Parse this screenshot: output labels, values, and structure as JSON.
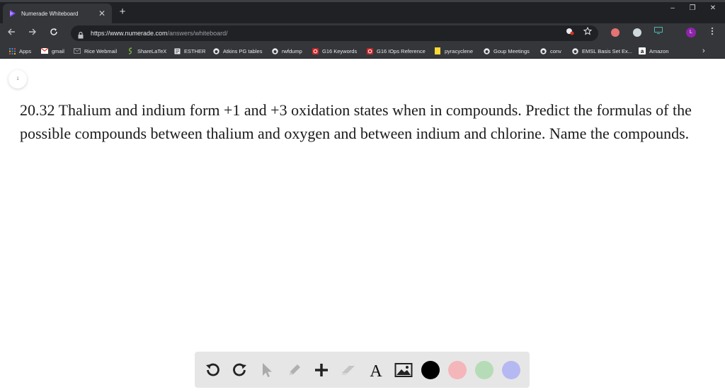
{
  "browser": {
    "tab": {
      "title": "Numerade Whiteboard",
      "close_glyph": "✕"
    },
    "new_tab_glyph": "+",
    "window_controls": {
      "minimize": "–",
      "restore": "❐",
      "close": "✕"
    },
    "url": {
      "host": "https://www.numerade.com",
      "path": "/answers/whiteboard/"
    },
    "avatar_letter": "L",
    "bookmarks": [
      {
        "label": "Apps",
        "icon": "apps-grid-icon"
      },
      {
        "label": "gmail",
        "icon": "gmail-icon"
      },
      {
        "label": "Rice Webmail",
        "icon": "webmail-icon"
      },
      {
        "label": "ShareLaTeX",
        "icon": "sharelatex-icon"
      },
      {
        "label": "ESTHER",
        "icon": "page-icon"
      },
      {
        "label": "Atkins PG tables",
        "icon": "github-icon"
      },
      {
        "label": "rwfdump",
        "icon": "github-icon"
      },
      {
        "label": "G16 Keywords",
        "icon": "gaussian-icon"
      },
      {
        "label": "G16 IOps Reference",
        "icon": "gaussian-icon"
      },
      {
        "label": "pyracyclene",
        "icon": "bookmark-folder-icon"
      },
      {
        "label": "Goup Meetings",
        "icon": "github-icon"
      },
      {
        "label": "conv",
        "icon": "github-icon"
      },
      {
        "label": "EMSL Basis Set Ex...",
        "icon": "github-icon"
      },
      {
        "label": "Amazon",
        "icon": "amazon-icon"
      }
    ],
    "colors": {
      "tabstrip": "#202124",
      "toolbar": "#35363a",
      "avatar": "#8e24aa"
    }
  },
  "whiteboard": {
    "page_number": "1",
    "question_text": "20.32 Thalium and indium form +1 and +3 oxidation states when in compounds. Predict the formulas of the possible compounds between thalium and oxygen and between indium and chlorine. Name the compounds.",
    "tools": [
      "undo-icon",
      "redo-icon",
      "pointer-icon",
      "pen-icon",
      "add-icon",
      "eraser-icon",
      "text-icon",
      "image-icon"
    ],
    "text_tool_glyph": "A",
    "colors": [
      "#000000",
      "#f4b6b9",
      "#b5dcb6",
      "#b6b8f2"
    ]
  }
}
